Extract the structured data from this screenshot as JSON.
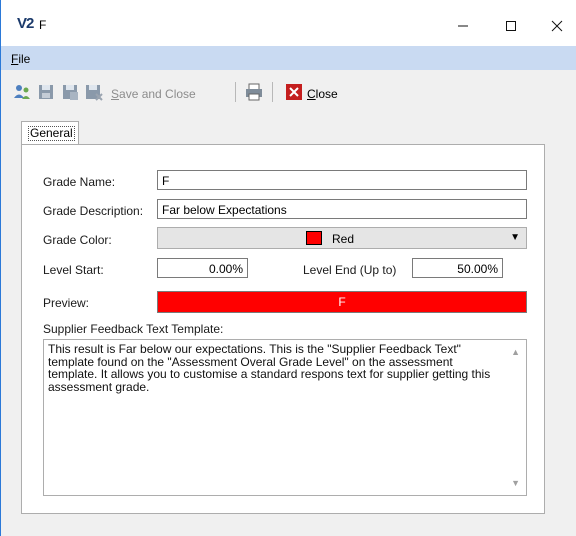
{
  "window": {
    "logo": "V2",
    "title": "F",
    "minimize_glyph": "—",
    "maximize_glyph": "☐",
    "close_glyph": "✕"
  },
  "menu": {
    "file_label": "File",
    "file_accel": "F",
    "file_rest": "ile"
  },
  "toolbar": {
    "icons": [
      "users-icon",
      "save-icon",
      "save-as-icon",
      "save-and-close-icon",
      "print-icon",
      "close-red-icon"
    ],
    "save_and_close_label": "Save and Close",
    "save_and_close_accel": "S",
    "save_and_close_rest": "ave and Close",
    "close_label": "Close",
    "close_accel": "C",
    "close_rest": "lose"
  },
  "tabs": [
    {
      "label": "General",
      "active": true
    }
  ],
  "form": {
    "grade_name_label": "Grade Name:",
    "grade_name_value": "F",
    "grade_description_label": "Grade Description:",
    "grade_description_value": "Far below Expectations",
    "grade_color_label": "Grade Color:",
    "grade_color_value": "Red",
    "grade_color_hex": "#ff0000",
    "level_start_label": "Level Start:",
    "level_start_value": "0.00%",
    "level_end_label": "Level End (Up to)",
    "level_end_value": "50.00%",
    "preview_label": "Preview:",
    "preview_text": "F",
    "template_label": "Supplier Feedback Text Template:",
    "template_text": "This result is Far below our expectations. This is the \"Supplier Feedback Text\" template found on the \"Assessment Overal Grade Level\" on the assessment template. It allows you to customise a standard respons text for supplier getting this assessment grade."
  },
  "colors": {
    "menubar": "#c9daf2",
    "accent_border": "#2b79d8",
    "preview_fill": "#ff0000"
  }
}
